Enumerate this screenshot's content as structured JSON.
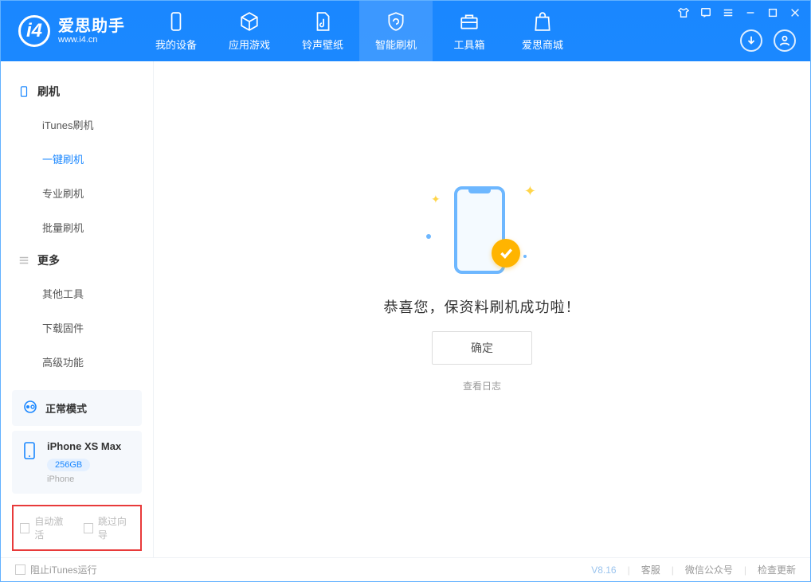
{
  "app": {
    "title": "爱思助手",
    "subtitle": "www.i4.cn"
  },
  "nav": {
    "tabs": [
      {
        "label": "我的设备"
      },
      {
        "label": "应用游戏"
      },
      {
        "label": "铃声壁纸"
      },
      {
        "label": "智能刷机"
      },
      {
        "label": "工具箱"
      },
      {
        "label": "爱思商城"
      }
    ]
  },
  "sidebar": {
    "group1_title": "刷机",
    "group1_items": [
      {
        "label": "iTunes刷机"
      },
      {
        "label": "一键刷机"
      },
      {
        "label": "专业刷机"
      },
      {
        "label": "批量刷机"
      }
    ],
    "group2_title": "更多",
    "group2_items": [
      {
        "label": "其他工具"
      },
      {
        "label": "下载固件"
      },
      {
        "label": "高级功能"
      }
    ],
    "mode_label": "正常模式",
    "device": {
      "name": "iPhone XS Max",
      "storage": "256GB",
      "type": "iPhone"
    },
    "checkbox1": "自动激活",
    "checkbox2": "跳过向导"
  },
  "main": {
    "success_message": "恭喜您，保资料刷机成功啦！",
    "confirm_button": "确定",
    "view_log": "查看日志"
  },
  "footer": {
    "block_itunes": "阻止iTunes运行",
    "version": "V8.16",
    "customer_service": "客服",
    "wechat": "微信公众号",
    "check_update": "检查更新"
  }
}
